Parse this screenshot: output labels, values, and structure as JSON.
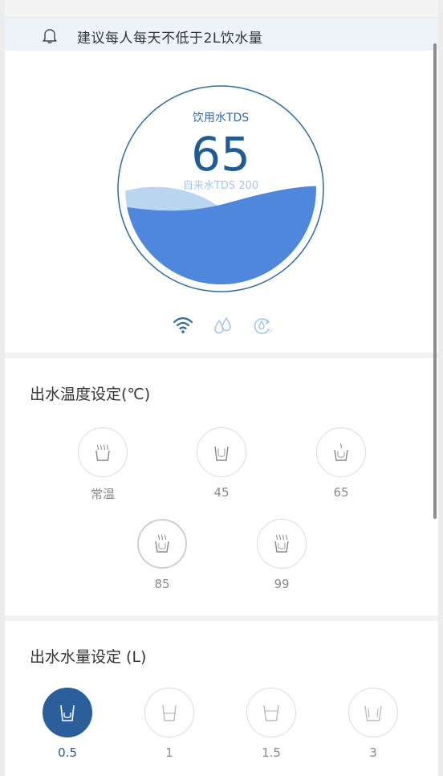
{
  "notice": {
    "text": "建议每人每天不低于2L饮水量",
    "icon": "bell-icon"
  },
  "gauge": {
    "title": "饮用水TDS",
    "value": "65",
    "subtitle": "自来水TDS 200",
    "water_level": 0.55,
    "colors": {
      "ring": "#2c6aa5",
      "wave": "#4f87dd",
      "wave_light": "#b9d5ef"
    }
  },
  "status_icons": [
    "wifi-icon",
    "water-drops-icon",
    "recycle-drop-icon"
  ],
  "temperature": {
    "title": "出水温度设定(℃)",
    "options": [
      {
        "label": "常温"
      },
      {
        "label": "45"
      },
      {
        "label": "65"
      },
      {
        "label": "85"
      },
      {
        "label": "99"
      }
    ],
    "selected_index": 3
  },
  "volume": {
    "title": "出水水量设定 (L)",
    "options": [
      {
        "label": "0.5"
      },
      {
        "label": "1"
      },
      {
        "label": "1.5"
      },
      {
        "label": "3"
      }
    ],
    "selected_index": 0,
    "accent": "#2a5f9b"
  }
}
